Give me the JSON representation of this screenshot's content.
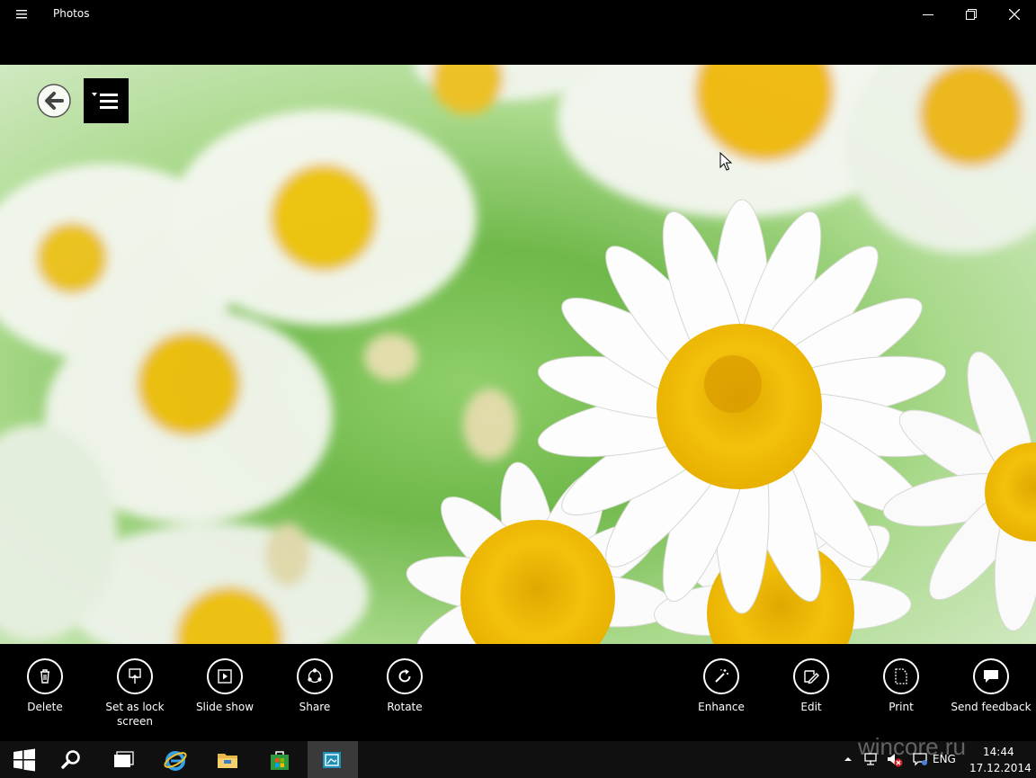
{
  "window": {
    "title": "Photos",
    "menu_icon": "hamburger-icon",
    "controls": [
      "minimize-icon",
      "maximize-icon",
      "close-icon"
    ]
  },
  "viewer": {
    "back_icon": "back-arrow-icon",
    "menu_icon": "photo-menu-icon"
  },
  "app_bar": {
    "left": [
      {
        "label": "Delete",
        "icon": "trash-icon"
      },
      {
        "label": "Set as lock screen",
        "icon": "lock-screen-icon"
      },
      {
        "label": "Slide show",
        "icon": "slideshow-icon"
      },
      {
        "label": "Share",
        "icon": "share-icon"
      },
      {
        "label": "Rotate",
        "icon": "rotate-icon"
      }
    ],
    "right": [
      {
        "label": "Enhance",
        "icon": "magic-wand-icon"
      },
      {
        "label": "Edit",
        "icon": "edit-icon"
      },
      {
        "label": "Print",
        "icon": "print-icon"
      },
      {
        "label": "Send feedback",
        "icon": "feedback-icon"
      }
    ]
  },
  "taskbar": {
    "items": [
      "windows-start-icon",
      "search-icon",
      "task-view-icon",
      "internet-explorer-icon",
      "file-explorer-icon",
      "store-icon",
      "photos-app-icon"
    ],
    "tray": {
      "language": "ENG",
      "time": "14:44",
      "date": "17.12.2014"
    }
  },
  "watermark": "wincore.ru"
}
